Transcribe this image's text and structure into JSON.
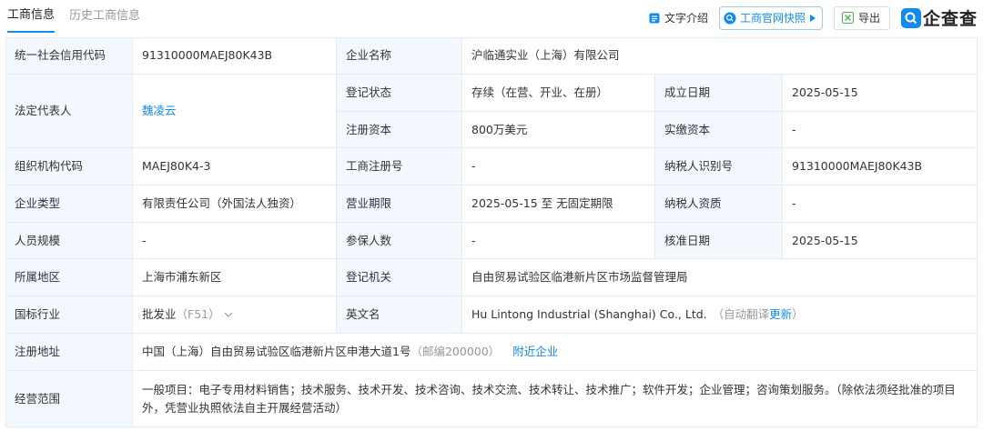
{
  "tabs": [
    "工商信息",
    "历史工商信息"
  ],
  "actions": {
    "text_intro": "文字介绍",
    "snapshot": "工商官网快照",
    "export": "导出"
  },
  "brand": "企查查",
  "labels": {
    "credit_code": "统一社会信用代码",
    "company_name": "企业名称",
    "legal_rep": "法定代表人",
    "reg_status": "登记状态",
    "est_date": "成立日期",
    "reg_capital": "注册资本",
    "paid_capital": "实缴资本",
    "org_code": "组织机构代码",
    "biz_reg_no": "工商注册号",
    "taxpayer_id": "纳税人识别号",
    "company_type": "企业类型",
    "biz_term": "营业期限",
    "taxpayer_qual": "纳税人资质",
    "staff_size": "人员规模",
    "insured": "参保人数",
    "approval_date": "核准日期",
    "region": "所属地区",
    "reg_authority": "登记机关",
    "industry": "国标行业",
    "english_name": "英文名",
    "reg_address": "注册地址",
    "biz_scope": "经营范围"
  },
  "values": {
    "credit_code": "91310000MAEJ80K43B",
    "company_name": "沪临通实业（上海）有限公司",
    "legal_rep": "魏凌云",
    "reg_status": "存续（在营、开业、在册）",
    "est_date": "2025-05-15",
    "reg_capital": "800万美元",
    "paid_capital": "-",
    "org_code": "MAEJ80K4-3",
    "biz_reg_no": "-",
    "taxpayer_id": "91310000MAEJ80K43B",
    "company_type": "有限责任公司（外国法人独资）",
    "biz_term": "2025-05-15 至 无固定期限",
    "taxpayer_qual": "-",
    "staff_size": "-",
    "insured": "-",
    "approval_date": "2025-05-15",
    "region": "上海市浦东新区",
    "reg_authority": "自由贸易试验区临港新片区市场监督管理局",
    "industry": "批发业",
    "industry_code": "（F51）",
    "english_name": "Hu Lintong Industrial (Shanghai) Co., Ltd.",
    "translate_note": "（自动翻译",
    "translate_update": "更新",
    "translate_close": "）",
    "reg_address": "中国（上海）自由贸易试验区临港新片区申港大道1号",
    "postcode": "（邮编200000）",
    "nearby": "附近企业",
    "biz_scope": "一般项目：电子专用材料销售；技术服务、技术开发、技术咨询、技术交流、技术转让、技术推广；软件开发；企业管理；咨询策划服务。（除依法须经批准的项目外，凭营业执照依法自主开展经营活动）"
  },
  "colors": {
    "accent": "#128bed",
    "label_bg": "#f2f8fe",
    "border": "#e4ebf3"
  }
}
